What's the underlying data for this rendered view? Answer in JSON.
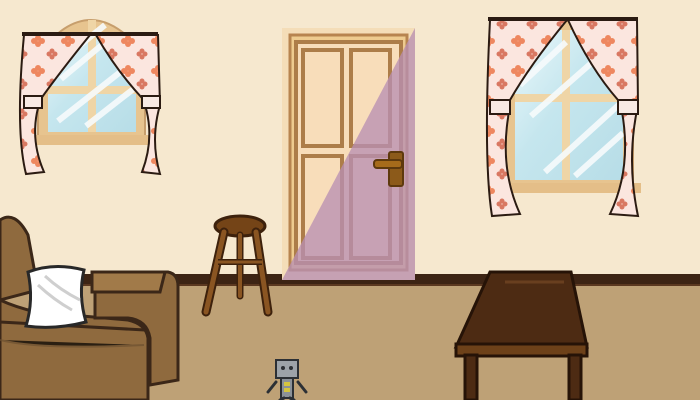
{
  "scene": {
    "type": "room-escape-scene",
    "objects": [
      "left-window",
      "right-window",
      "door",
      "wooden-stool",
      "sofa",
      "white-pillow",
      "wooden-table",
      "toy-robot"
    ]
  },
  "colors": {
    "wall": "#f6e8cf",
    "floor": "#bea176",
    "baseboard": "#3d2414",
    "door_frame": "#eecb8f",
    "door_panel": "#f8ddba",
    "door_shadow": "#c7a4bd",
    "wood_dark": "#4d2b13",
    "wood_mid": "#6d4119",
    "sofa": "#8f6a3e",
    "sofa_dark": "#5c4428",
    "glass": "#c9e8ef",
    "curtain": "#fbe6df",
    "flower": "#ee875f",
    "robot": "#9da3a9"
  }
}
